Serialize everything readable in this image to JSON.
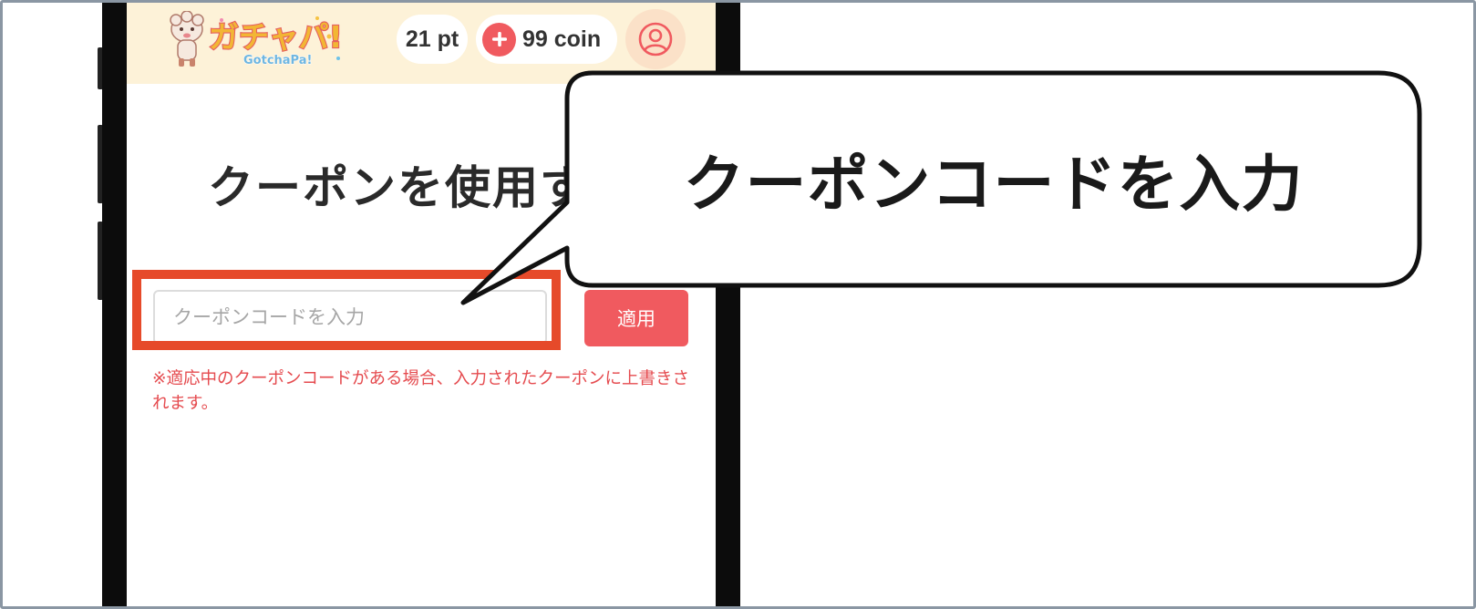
{
  "header": {
    "logo_text": "ガチャパ!",
    "logo_subtext": "GotchaPa!",
    "points_label": "21 pt",
    "coins_label": "99 coin"
  },
  "page": {
    "title": "クーポンを使用する"
  },
  "coupon_form": {
    "input_value": "",
    "input_placeholder": "クーポンコードを入力",
    "apply_label": "適用",
    "notice": "※適応中のクーポンコードがある場合、入力されたクーポンに上書きされます。"
  },
  "annotation": {
    "callout_text": "クーポンコードを入力"
  },
  "icons": {
    "coin_plus": "plus-icon",
    "account": "user-circle-icon"
  },
  "colors": {
    "header_bg": "#fdf2d8",
    "accent_red": "#f05a5f",
    "highlight_red": "#e64a2a",
    "notice_red": "#e54b4f",
    "avatar_bg": "#fbe1c8"
  }
}
